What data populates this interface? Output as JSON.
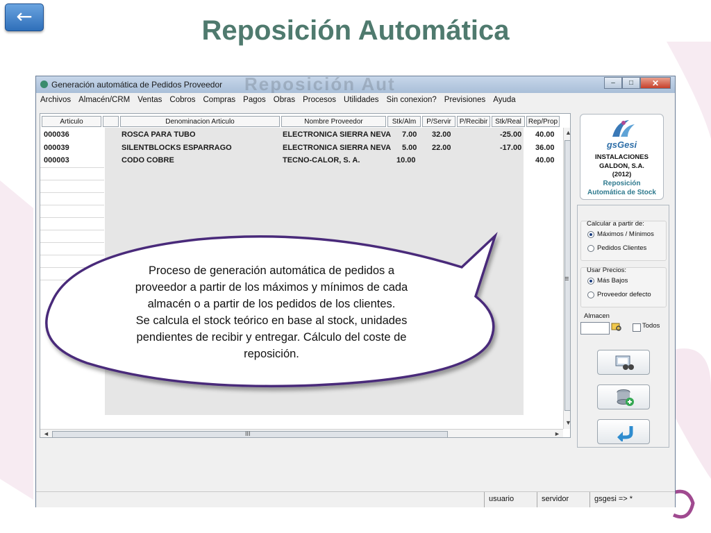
{
  "slide": {
    "title": "Reposición Automática",
    "back_icon": "←"
  },
  "window": {
    "title": "Generación automática de Pedidos Proveedor",
    "ghost_text": "Reposición Aut",
    "controls": [
      "–",
      "□",
      "✕"
    ]
  },
  "menu": [
    "Archivos",
    "Almacén/CRM",
    "Ventas",
    "Cobros",
    "Compras",
    "Pagos",
    "Obras",
    "Procesos",
    "Utilidades",
    "Sin conexion?",
    "Previsiones",
    "Ayuda"
  ],
  "grid": {
    "headers": [
      "Articulo",
      "",
      "Denominacion Articulo",
      "Nombre Proveedor",
      "Stk/Alm",
      "P/Servir",
      "P/Recibir",
      "Stk/Real",
      "Rep/Prop"
    ],
    "rows": [
      [
        "000036",
        "ROSCA PARA TUBO",
        "ELECTRONICA SIERRA NEVA",
        "7.00",
        "32.00",
        "",
        "-25.00",
        "40.00"
      ],
      [
        "000039",
        "SILENTBLOCKS ESPARRAGO",
        "ELECTRONICA SIERRA NEVA",
        "5.00",
        "22.00",
        "",
        "-17.00",
        "36.00"
      ],
      [
        "000003",
        "CODO COBRE",
        "TECNO-CALOR, S. A.",
        "10.00",
        "",
        "",
        "",
        "40.00"
      ]
    ],
    "hscroll_grip": "III",
    "vscroll_grip": "≡"
  },
  "logo": {
    "name": "gsGesi",
    "company": [
      "INSTALACIONES",
      "GALDON, S.A.",
      "(2012)"
    ],
    "subtitle": [
      "Reposición",
      "Automática de Stock"
    ]
  },
  "panel": {
    "calc_label": "Calcular a partir de:",
    "calc_options": [
      "Máximos / Mínimos",
      "Pedidos Clientes"
    ],
    "price_label": "Usar Precios:",
    "price_options": [
      "Más Bajos",
      "Proveedor defecto"
    ],
    "almacen_label": "Almacen",
    "todos_label": "Todos"
  },
  "status": {
    "usuario": "usuario",
    "servidor": "servidor",
    "session": "gsgesi => *"
  },
  "callout": {
    "lines": [
      "Proceso de generación automática de pedidos a",
      "proveedor a partir de los máximos y mínimos de cada",
      "almacén o a partir de los pedidos de los clientes.",
      "Se calcula el stock teórico en base al stock, unidades",
      "pendientes de recibir y entregar.  Cálculo del coste de",
      "reposición."
    ]
  },
  "colors": {
    "title": "#4f7a6e",
    "accent_pink": "#ead0e0",
    "logo_blue": "#2f6fa8"
  }
}
